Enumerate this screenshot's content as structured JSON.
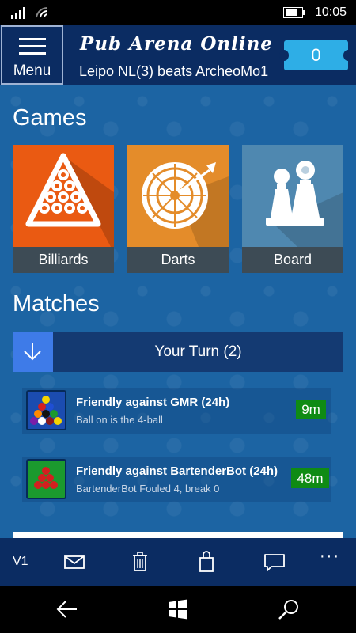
{
  "status_bar": {
    "time": "10:05"
  },
  "header": {
    "menu_label": "Menu",
    "app_title": "Pub Arena Online",
    "ticker_text": "Leipo NL(3) beats ArcheoMo1",
    "coin_count": "0"
  },
  "games": {
    "heading": "Games",
    "tiles": [
      {
        "label": "Billiards",
        "icon": "billiard-rack-icon",
        "color": "#ea5a12"
      },
      {
        "label": "Darts",
        "icon": "dartboard-icon",
        "color": "#e48c2a"
      },
      {
        "label": "Board",
        "icon": "chess-pawns-icon",
        "color": "#4f88b0"
      }
    ]
  },
  "matches": {
    "heading": "Matches",
    "group_label": "Your Turn (2)",
    "items": [
      {
        "title": "Friendly against GMR (24h)",
        "subtitle": "Ball on is the 4-ball",
        "time_left": "9m",
        "icon": "pool-rack-icon"
      },
      {
        "title": "Friendly against BartenderBot (24h)",
        "subtitle": "BartenderBot Fouled 4, break 0",
        "time_left": "48m",
        "icon": "snooker-rack-icon"
      }
    ]
  },
  "app_bar": {
    "version": "V1",
    "buttons": [
      "mail-icon",
      "trash-icon",
      "shopping-bag-icon",
      "chat-icon",
      "more-icon"
    ],
    "more_label": "···"
  },
  "colors": {
    "header_bg": "#0b2c62",
    "content_bg": "#1c64a3",
    "accent_blue": "#3e7be8",
    "badge_green": "#0f8b14",
    "coin_cyan": "#2eaee6"
  }
}
